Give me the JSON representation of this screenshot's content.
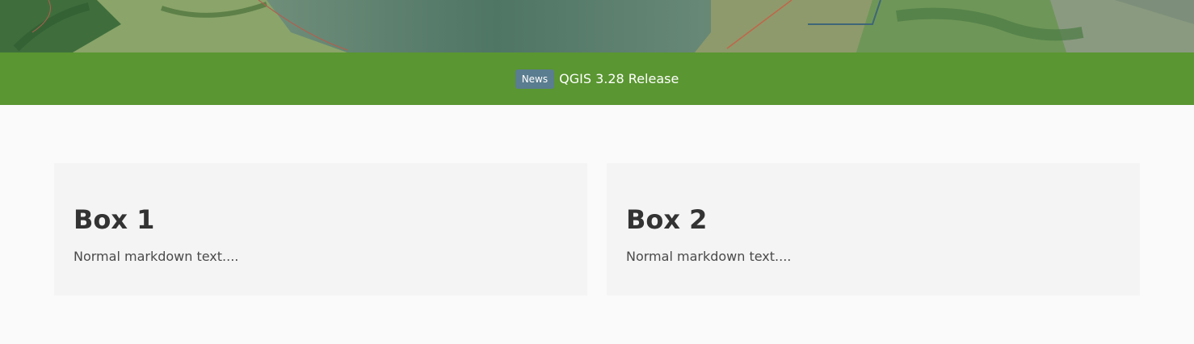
{
  "colors": {
    "news_bar": "#5a9631",
    "badge": "#5a7d8f",
    "page_bg": "#fafafa",
    "box_bg": "#f4f4f4",
    "heading": "#333333",
    "body_text": "#4a4a4a"
  },
  "news": {
    "badge": "News",
    "title": "QGIS 3.28 Release"
  },
  "boxes": [
    {
      "title": "Box 1",
      "text": "Normal markdown text...."
    },
    {
      "title": "Box 2",
      "text": "Normal markdown text...."
    }
  ]
}
